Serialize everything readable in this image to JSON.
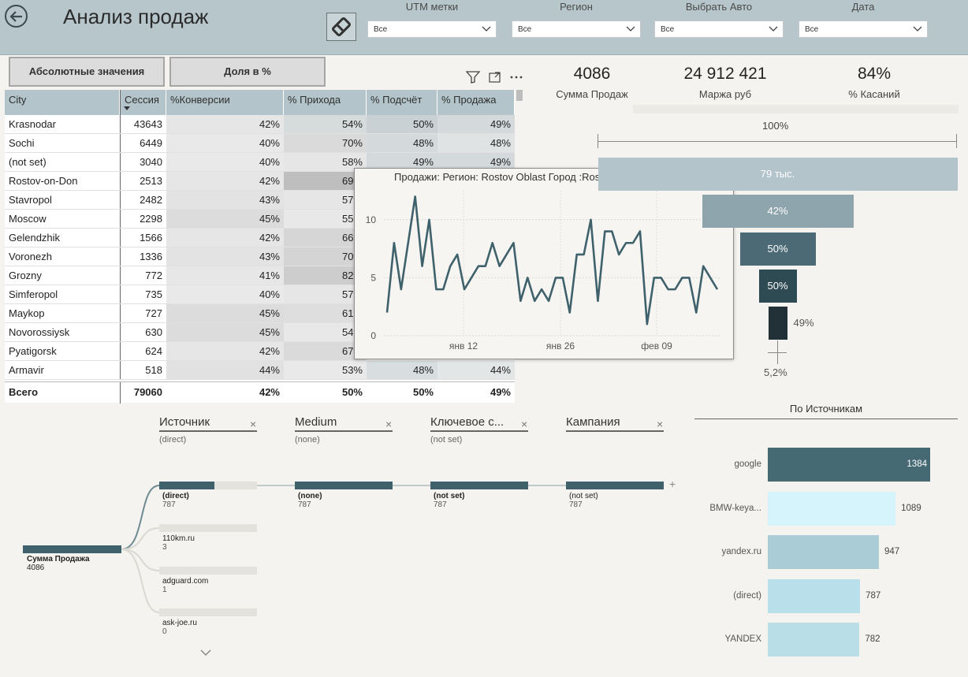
{
  "header": {
    "title": "Анализ продаж",
    "slicers": [
      {
        "label": "UTM метки",
        "value": "Все"
      },
      {
        "label": "Регион",
        "value": "Все"
      },
      {
        "label": "Выбрать Авто",
        "value": "Все"
      },
      {
        "label": "Дата",
        "value": "Все"
      }
    ]
  },
  "toggles": {
    "absolute": "Абсолютные значения",
    "share": "Доля в %"
  },
  "table": {
    "columns": [
      "City",
      "Сессия",
      "%Конверсии",
      "% Прихода",
      "% Подсчёт",
      "% Продажа"
    ],
    "rows": [
      [
        "Krasnodar",
        "43643",
        "42%",
        "54%",
        "50%",
        "49%"
      ],
      [
        "Sochi",
        "6449",
        "40%",
        "70%",
        "48%",
        "48%"
      ],
      [
        "(not set)",
        "3040",
        "40%",
        "58%",
        "49%",
        "49%"
      ],
      [
        "Rostov-on-Don",
        "2513",
        "42%",
        "69%",
        "",
        ""
      ],
      [
        "Stavropol",
        "2482",
        "43%",
        "57%",
        "",
        ""
      ],
      [
        "Moscow",
        "2298",
        "45%",
        "55%",
        "",
        ""
      ],
      [
        "Gelendzhik",
        "1566",
        "42%",
        "66%",
        "",
        ""
      ],
      [
        "Voronezh",
        "1336",
        "43%",
        "70%",
        "",
        ""
      ],
      [
        "Grozny",
        "772",
        "41%",
        "82%",
        "",
        ""
      ],
      [
        "Simferopol",
        "735",
        "40%",
        "57%",
        "",
        ""
      ],
      [
        "Maykop",
        "727",
        "45%",
        "61%",
        "",
        ""
      ],
      [
        "Novorossiysk",
        "630",
        "45%",
        "54%",
        "",
        ""
      ],
      [
        "Pyatigorsk",
        "624",
        "42%",
        "67%",
        "",
        ""
      ],
      [
        "Armavir",
        "518",
        "44%",
        "53%",
        "48%",
        "44%"
      ]
    ],
    "total": [
      "Всего",
      "79060",
      "42%",
      "50%",
      "50%",
      "49%"
    ]
  },
  "kpis": [
    {
      "value": "4086",
      "label": "Сумма Продаж"
    },
    {
      "value": "24 912 421",
      "label": "Маржа руб"
    },
    {
      "value": "84%",
      "label": "% Касаний"
    }
  ],
  "funnel": {
    "top_label": "100%",
    "bars": [
      {
        "label": "79 тыс.",
        "value": 1.0,
        "color": "#b3c5cb"
      },
      {
        "label": "42%",
        "value": 0.42,
        "color": "#8fa5ad"
      },
      {
        "label": "50%",
        "value": 0.5,
        "color": "#4b6a75"
      },
      {
        "label": "50%",
        "value": 0.5,
        "color": "#2e4a53"
      },
      {
        "label": "49%",
        "value": 0.49,
        "color": "#213137"
      }
    ],
    "bottom_label": "5,2%"
  },
  "popup": {
    "title": "Продажи: Регион: Rostov Oblast Город :Rostov-on-D"
  },
  "chart_data": {
    "type": "line",
    "title": "Продажи: Регион: Rostov Oblast Город :Rostov-on-D",
    "x_ticks": [
      "янв 12",
      "янв 26",
      "фев 09"
    ],
    "y_ticks": [
      0,
      5,
      10
    ],
    "ylim": [
      0,
      12.5
    ],
    "values": [
      2,
      8,
      4,
      8,
      12,
      6,
      10,
      4,
      4,
      6,
      7,
      4,
      5,
      6,
      6,
      8,
      6,
      7,
      8,
      3,
      5,
      3,
      4,
      3,
      5,
      5,
      2,
      7,
      7,
      10,
      3,
      9,
      9,
      7,
      8,
      8,
      9,
      1,
      5,
      5,
      4,
      4,
      5,
      5,
      2,
      6,
      5,
      4
    ],
    "series_color": "#3f616b"
  },
  "decomp": {
    "levels": [
      {
        "title": "Источник",
        "sub": "(direct)"
      },
      {
        "title": "Medium",
        "sub": "(none)"
      },
      {
        "title": "Ключевое с...",
        "sub": "(not set)"
      },
      {
        "title": "Кампания",
        "sub": ""
      }
    ],
    "root": {
      "label": "Сумма Продажа",
      "value": "4086"
    },
    "source_nodes": [
      {
        "label": "(direct)",
        "value": "787"
      },
      {
        "label": "110km.ru",
        "value": "3"
      },
      {
        "label": "adguard.com",
        "value": "1"
      },
      {
        "label": "ask-joe.ru",
        "value": "0"
      }
    ],
    "chain": [
      {
        "label": "(none)",
        "value": "787"
      },
      {
        "label": "(not set)",
        "value": "787"
      },
      {
        "label": "(not set)",
        "value": "787"
      }
    ]
  },
  "sources": {
    "title": "По Источникам",
    "items": [
      {
        "name": "google",
        "value": 1384,
        "color": "#466a74"
      },
      {
        "name": "BMW-keya...",
        "value": 1089,
        "color": "#d5f4fb"
      },
      {
        "name": "yandex.ru",
        "value": 947,
        "color": "#a9ccd7"
      },
      {
        "name": "(direct)",
        "value": 787,
        "color": "#b9e0ea"
      },
      {
        "name": "YANDEX",
        "value": 782,
        "color": "#b9dee8"
      }
    ]
  }
}
